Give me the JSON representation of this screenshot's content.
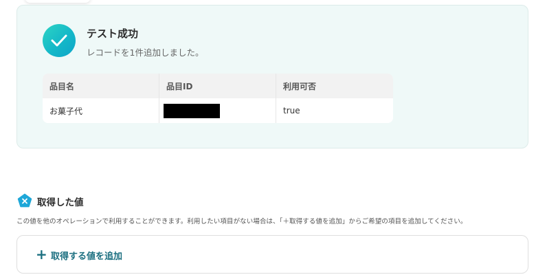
{
  "test_result": {
    "title": "テスト成功",
    "message": "レコードを1件追加しました。",
    "table": {
      "headers": [
        "品目名",
        "品目ID",
        "利用可否"
      ],
      "row": {
        "name": "お菓子代",
        "id": "[redacted]",
        "availability": "true"
      }
    }
  },
  "acquired_values": {
    "title": "取得した値",
    "description": "この値を他のオペレーションで利用することができます。利用したい項目がない場合は、「＋取得する値を追加」からご希望の項目を追加してください。",
    "add_button": {
      "icon": "+",
      "label": "取得する値を追加"
    }
  },
  "colors": {
    "success_card_bg": "#eff9f8",
    "check_gradient_start": "#2dd4c4",
    "check_gradient_end": "#0ea5c9",
    "accent": "#1b6f80",
    "section_icon": "#1ea7d8"
  },
  "icons": {
    "success": "check-circle-icon",
    "section": "pentagon-x-icon"
  }
}
